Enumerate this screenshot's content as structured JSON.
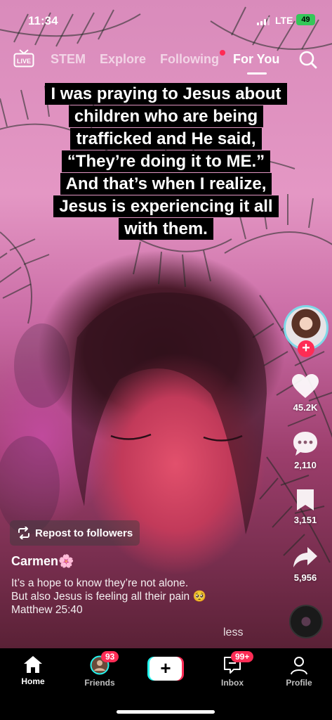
{
  "status_bar": {
    "time": "11:34",
    "network": "LTE",
    "battery": "49"
  },
  "top_nav": {
    "live_label": "LIVE",
    "tabs": [
      {
        "label": "STEM"
      },
      {
        "label": "Explore"
      },
      {
        "label": "Following"
      },
      {
        "label": "For You"
      }
    ],
    "active_tab": "For You"
  },
  "caption": {
    "lines": [
      "I was praying to Jesus about",
      "children who are being",
      "trafficked and He said,",
      "“They’re doing it to ME.”",
      "And that’s when I realize,",
      "Jesus is experiencing it all",
      "with them."
    ]
  },
  "rail": {
    "likes": "45.2K",
    "comments": "2,110",
    "saves": "3,151",
    "shares": "5,956"
  },
  "post": {
    "repost_label": "Repost to followers",
    "username": "Carmen🌸",
    "description_lines": [
      "It’s a hope to know they’re not alone.",
      "But also Jesus is feeling all their pain 🥺",
      "Matthew 25:40"
    ],
    "less_label": "less"
  },
  "bottom_nav": {
    "home": "Home",
    "friends": "Friends",
    "friends_badge": "93",
    "inbox": "Inbox",
    "inbox_badge": "99+",
    "profile": "Profile"
  },
  "colors": {
    "accent_red": "#fe2c55",
    "accent_cyan": "#25f4ee",
    "battery_green": "#34c759"
  }
}
